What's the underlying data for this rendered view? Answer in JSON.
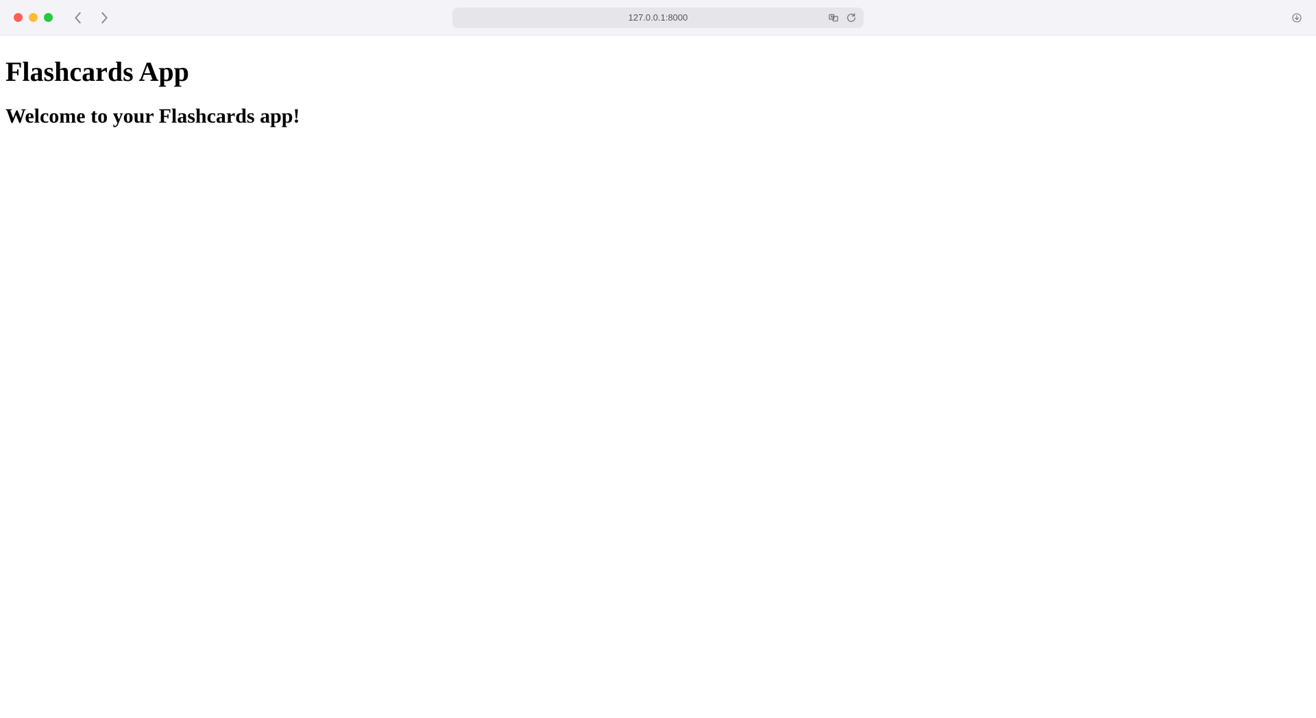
{
  "browser": {
    "url": "127.0.0.1:8000"
  },
  "page": {
    "title": "Flashcards App",
    "subtitle": "Welcome to your Flashcards app!"
  }
}
